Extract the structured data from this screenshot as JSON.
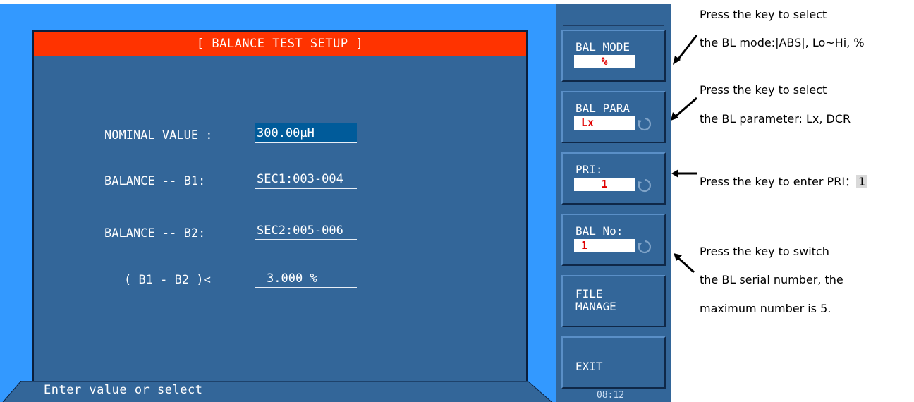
{
  "screen": {
    "title": "[ BALANCE TEST SETUP ]",
    "fields": [
      {
        "label": "NOMINAL VALUE :",
        "value": "300.00μH"
      },
      {
        "label": "BALANCE -- B1:",
        "value": "SEC1:003-004"
      },
      {
        "label": "BALANCE -- B2:",
        "value": "SEC2:005-006"
      },
      {
        "label": "( B1 - B2 )<",
        "value": "3.000 %"
      }
    ],
    "status": "Enter value or select",
    "clock": "08:12"
  },
  "softkeys": {
    "bal_mode": {
      "label": "BAL MODE",
      "value": "%"
    },
    "bal_para": {
      "label": "BAL PARA",
      "value": "Lx"
    },
    "pri": {
      "label": "PRI:",
      "value": "1"
    },
    "bal_no": {
      "label": "BAL No:",
      "value": "1"
    },
    "file_manage": {
      "label": "FILE\nMANAGE"
    },
    "exit": {
      "label": "EXIT"
    }
  },
  "notes": {
    "mode_line1": "Press the key to select",
    "mode_line2": "the BL mode:|ABS|, Lo~Hi, %",
    "para_line1": "Press the key to select",
    "para_line2": "the BL parameter: Lx, DCR",
    "pri_text": "Press the key to enter PRI：",
    "pri_value": "1",
    "no_line1": "Press the key to switch",
    "no_line2": "the BL serial number, the",
    "no_line3": "maximum number is 5."
  },
  "colors": {
    "screen_background": "#3399ff",
    "panel": "#336699",
    "title_bar": "#ff3300",
    "value_text": "#e00000"
  }
}
